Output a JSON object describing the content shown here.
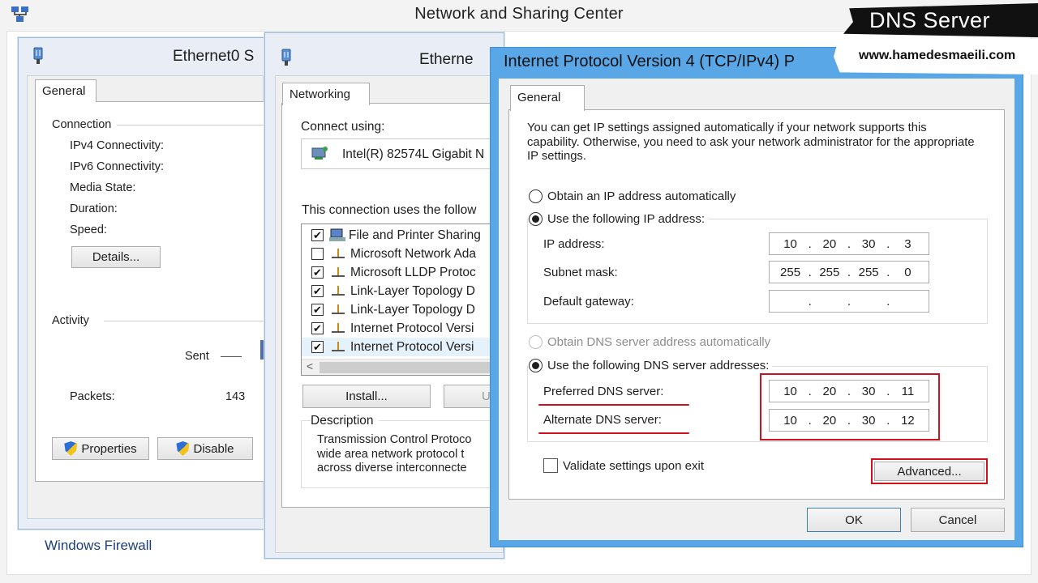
{
  "nsc": {
    "title": "Network and Sharing Center",
    "windows_firewall": "Windows Firewall"
  },
  "status_window": {
    "title": "Ethernet0 S",
    "tab": "General",
    "connection_label": "Connection",
    "rows": [
      "IPv4 Connectivity:",
      "IPv6 Connectivity:",
      "Media State:",
      "Duration:",
      "Speed:"
    ],
    "details_button": "Details...",
    "activity_label": "Activity",
    "sent_label": "Sent",
    "packets_label": "Packets:",
    "packets_value": "143",
    "properties_button": "Properties",
    "disable_button": "Disable"
  },
  "props_window": {
    "title": "Etherne",
    "tab": "Networking",
    "connect_using": "Connect using:",
    "adapter": "Intel(R) 82574L Gigabit N",
    "uses_following": "This connection uses the follow",
    "items": [
      {
        "label": "File and Printer Sharing",
        "checked": true
      },
      {
        "label": "Microsoft Network Ada",
        "checked": false
      },
      {
        "label": "Microsoft LLDP Protoc",
        "checked": true
      },
      {
        "label": "Link-Layer Topology D",
        "checked": true
      },
      {
        "label": "Link-Layer Topology D",
        "checked": true
      },
      {
        "label": "Internet Protocol Versi",
        "checked": true
      },
      {
        "label": "Internet Protocol Versi",
        "checked": true
      }
    ],
    "scroll_left": "<",
    "install_button": "Install...",
    "uninstall_button": "U",
    "description_label": "Description",
    "description_text": "Transmission Control Protoco\nwide area network protocol t\nacross diverse interconnecte"
  },
  "ipv4_dialog": {
    "title": "Internet Protocol Version 4 (TCP/IPv4) P",
    "tab": "General",
    "intro": "You can get IP settings assigned automatically if your network supports this capability. Otherwise, you need to ask your network administrator for the appropriate IP settings.",
    "obtain_ip_auto": "Obtain an IP address automatically",
    "use_following_ip": "Use the following IP address:",
    "ip_address_label": "IP address:",
    "ip_address": [
      "10",
      "20",
      "30",
      "3"
    ],
    "subnet_label": "Subnet mask:",
    "subnet": [
      "255",
      "255",
      "255",
      "0"
    ],
    "gateway_label": "Default gateway:",
    "gateway": [
      "",
      "",
      "",
      ""
    ],
    "obtain_dns_auto": "Obtain DNS server address automatically",
    "use_following_dns": "Use the following DNS server addresses:",
    "preferred_dns_label": "Preferred DNS server:",
    "preferred_dns": [
      "10",
      "20",
      "30",
      "11"
    ],
    "alternate_dns_label": "Alternate DNS server:",
    "alternate_dns": [
      "10",
      "20",
      "30",
      "12"
    ],
    "validate_label": "Validate settings upon exit",
    "advanced_button": "Advanced...",
    "ok_button": "OK",
    "cancel_button": "Cancel",
    "highlight_color": "#d0101c"
  },
  "banner": {
    "title": "DNS Server",
    "url": "www.hamedesmaeili.com"
  }
}
